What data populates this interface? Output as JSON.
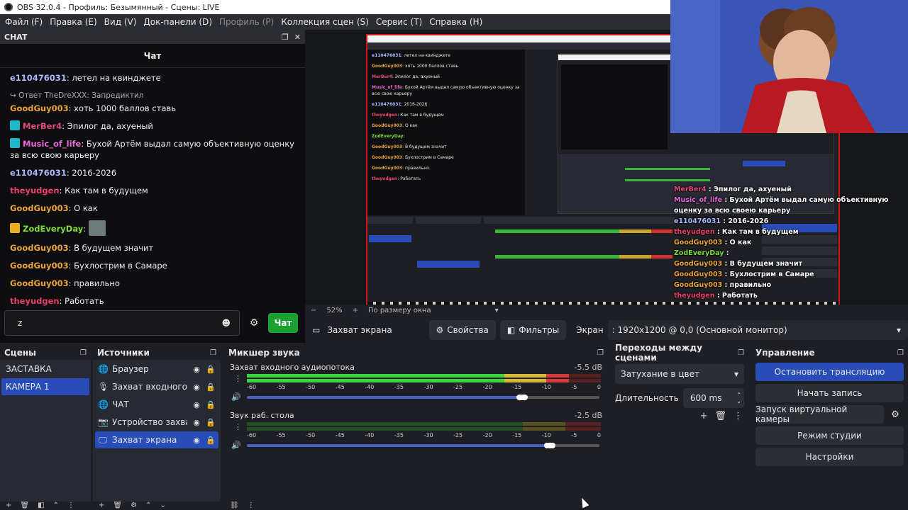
{
  "window": {
    "title": "OBS 32.0.4 - Профиль: Безымянный - Сцены: LIVE"
  },
  "menu": [
    {
      "label": "Файл (F)",
      "enabled": true
    },
    {
      "label": "Правка (E)",
      "enabled": true
    },
    {
      "label": "Вид (V)",
      "enabled": true
    },
    {
      "label": "Док-панели (D)",
      "enabled": true
    },
    {
      "label": "Профиль (P)",
      "enabled": false
    },
    {
      "label": "Коллекция сцен (S)",
      "enabled": true
    },
    {
      "label": "Сервис (T)",
      "enabled": true
    },
    {
      "label": "Справка (H)",
      "enabled": true
    }
  ],
  "chat_dock": {
    "header": "CHAT",
    "title": "Чат",
    "messages": [
      {
        "user": "e110476031",
        "text": ": летел на квинджете",
        "color": "#a9b8ff"
      },
      {
        "reply": "Ответ TheDreXXX: Запредиктил"
      },
      {
        "user": "GoodGuy003",
        "text": ": хоть 1000 баллов ставь",
        "color": "#e8a43a"
      },
      {
        "user": "MerBer4",
        "text": ": Эпилог да, ахуеный",
        "color": "#e04a7a",
        "badge": "#1fb8c9"
      },
      {
        "user": "Music_of_life",
        "text": ": Бухой Артём выдал самую объективную оценку за всю свою карьеру",
        "color": "#e667d6",
        "badge": "#1fb8c9"
      },
      {
        "user": "e110476031",
        "text": ": 2016-2026",
        "color": "#a9b8ff"
      },
      {
        "user": "theyudgen",
        "text": ": Как там в будущем",
        "color": "#ea3f6a"
      },
      {
        "user": "GoodGuy003",
        "text": ": О как",
        "color": "#e8a43a"
      },
      {
        "user": "ZodEveryDay",
        "text": ":",
        "color": "#7ddc3a",
        "badge": "#e8b020",
        "emote": true
      },
      {
        "user": "GoodGuy003",
        "text": ": В будущем значит",
        "color": "#e8a43a"
      },
      {
        "user": "GoodGuy003",
        "text": ": Бухлострим в Самаре",
        "color": "#e8a43a"
      },
      {
        "user": "GoodGuy003",
        "text": ": правильно",
        "color": "#e8a43a"
      },
      {
        "user": "theyudgen",
        "text": ": Работать",
        "color": "#ea3f6a"
      }
    ],
    "input_value": "z",
    "send_label": "Чат"
  },
  "preview": {
    "zoom": "52%",
    "fit": "По размеру окна",
    "overlay_chat": [
      {
        "user": "MerBer4",
        "text": " : Эпилог да, ахуеный",
        "color": "#e04a7a"
      },
      {
        "user": "Music_of_life",
        "text": " : Бухой Артём выдал самую объективную оценку за всю своею карьеру",
        "color": "#e667d6"
      },
      {
        "user": "e110476031",
        "text": " : 2016-2026",
        "color": "#a9b8ff"
      },
      {
        "user": "theyudgen",
        "text": " : Как там в будущем",
        "color": "#ea3f6a"
      },
      {
        "user": "GoodGuy003",
        "text": " : О как",
        "color": "#e8a43a"
      },
      {
        "user": "ZodEveryDay",
        "text": " :",
        "color": "#7ddc3a"
      },
      {
        "user": "GoodGuy003",
        "text": " : В будущем значит",
        "color": "#e8a43a"
      },
      {
        "user": "GoodGuy003",
        "text": " : Бухлострим в Самаре",
        "color": "#e8a43a"
      },
      {
        "user": "GoodGuy003",
        "text": " : правильно",
        "color": "#e8a43a"
      },
      {
        "user": "theyudgen",
        "text": " : Работать",
        "color": "#ea3f6a"
      }
    ]
  },
  "props_bar": {
    "source_name": "Захват экрана",
    "properties_label": "Свойства",
    "filters_label": "Фильтры",
    "screen_label": "Экран",
    "monitor_value": ": 1920x1200 @ 0,0 (Основной монитор)"
  },
  "scenes": {
    "title": "Сцены",
    "items": [
      {
        "label": "ЗАСТАВКА",
        "selected": false
      },
      {
        "label": "КАМЕРА 1",
        "selected": true
      }
    ]
  },
  "sources": {
    "title": "Источники",
    "items": [
      {
        "label": "Браузер",
        "icon": "globe-icon",
        "glyph": "🌐",
        "selected": false
      },
      {
        "label": "Захват входного аудио",
        "icon": "microphone-icon",
        "glyph": "🎙",
        "selected": false
      },
      {
        "label": "ЧАТ",
        "icon": "globe-icon",
        "glyph": "🌐",
        "selected": false
      },
      {
        "label": "Устройство захвата",
        "icon": "camera-icon",
        "glyph": "📷",
        "selected": false
      },
      {
        "label": "Захват экрана",
        "icon": "monitor-icon",
        "glyph": "🖵",
        "selected": true
      }
    ]
  },
  "mixer": {
    "title": "Микшер звука",
    "ticks": [
      "-60",
      "-55",
      "-50",
      "-45",
      "-40",
      "-35",
      "-30",
      "-25",
      "-20",
      "-15",
      "-10",
      "-5",
      "0"
    ],
    "channels": [
      {
        "name": "Захват входного аудиопотока",
        "db": "-5.5 dB",
        "level": 0.91,
        "volume": 0.78
      },
      {
        "name": "Звук раб. стола",
        "db": "-2.5 dB",
        "level": 0.0,
        "volume": 0.86
      }
    ]
  },
  "transitions": {
    "title": "Переходы между сценами",
    "selected": "Затухание в цвет",
    "duration_label": "Длительность",
    "duration_value": "600 ms"
  },
  "controls": {
    "title": "Управление",
    "stop_stream": "Остановить трансляцию",
    "start_record": "Начать запись",
    "virtual_cam": "Запуск виртуальной камеры",
    "studio_mode": "Режим студии",
    "settings": "Настройки"
  },
  "colors": {
    "accent": "#284cb8",
    "chat_send": "#1ba130",
    "preview_border": "#d01818"
  }
}
